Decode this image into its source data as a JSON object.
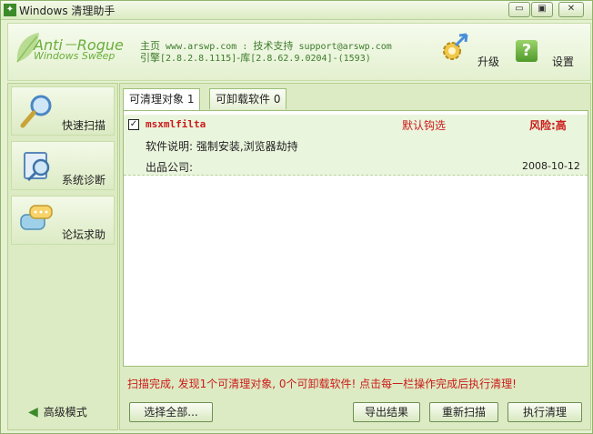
{
  "window": {
    "title": "Windows 清理助手",
    "controls": {
      "minimize": "▭",
      "maximize": "▣",
      "close": "✕"
    }
  },
  "header": {
    "logo_line1": "Anti－Rogue",
    "logo_line2": "Windows Sweep",
    "home_label": "主页",
    "home_url": "www.arswp.com",
    "separator": ":",
    "support_label": "技术支持",
    "support_email": "support@arswp.com",
    "engine_label": "引擎",
    "engine_version": "[2.8.2.8.1115]",
    "db_label": "-库",
    "db_version": "[2.8.62.9.0204]-(1593)",
    "upgrade_label": "升级",
    "settings_label": "设置",
    "upgrade_icon": "gear-arrow-icon",
    "settings_icon": "help-icon"
  },
  "sidebar": {
    "items": [
      {
        "label": "快速扫描",
        "icon": "magnifier-icon"
      },
      {
        "label": "系统诊断",
        "icon": "diagnosis-icon"
      },
      {
        "label": "论坛求助",
        "icon": "chat-bubble-icon"
      }
    ],
    "advanced_mode": "高级模式"
  },
  "tabs": [
    {
      "label": "可清理对象 1",
      "active": true
    },
    {
      "label": "可卸载软件 0",
      "active": false
    }
  ],
  "results": [
    {
      "checked": "✓",
      "name": "msxmlfilta",
      "default_state": "默认钩选",
      "risk": "风险:高",
      "description": "软件说明: 强制安装,浏览器劫持",
      "company": "出品公司:",
      "date": "2008-10-12"
    }
  ],
  "status_text": "扫描完成, 发现1个可清理对象, 0个可卸载软件! 点击每一栏操作完成后执行清理!",
  "buttons": {
    "select_all": "选择全部...",
    "export": "导出结果",
    "rescan": "重新扫描",
    "clean": "执行清理"
  },
  "colors": {
    "accent_green": "#6aae3b",
    "risk_red": "#cc1a1a"
  }
}
